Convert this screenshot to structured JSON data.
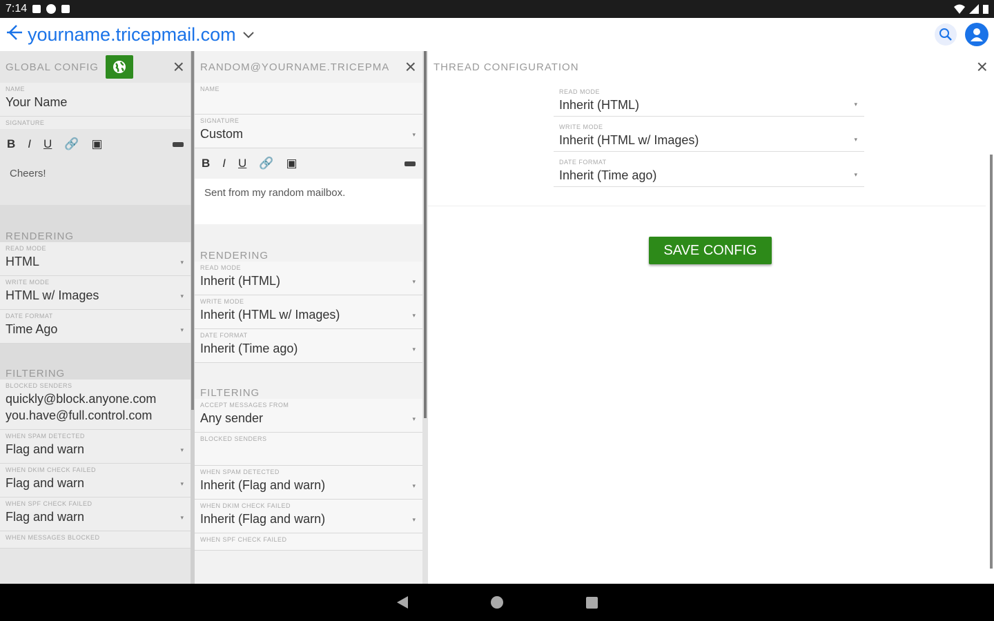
{
  "status": {
    "time": "7:14"
  },
  "appbar": {
    "title": "yourname.tricepmail.com",
    "title_prefix": "yourname",
    "title_suffix": ".tricepmail.com"
  },
  "global": {
    "header": "GLOBAL CONFIG",
    "name_label": "NAME",
    "name_value": "Your Name",
    "signature_label": "SIGNATURE",
    "signature_text": "Cheers!",
    "rendering_title": "RENDERING",
    "read_mode_label": "READ MODE",
    "read_mode": "HTML",
    "write_mode_label": "WRITE MODE",
    "write_mode": "HTML w/ Images",
    "date_format_label": "DATE FORMAT",
    "date_format": "Time Ago",
    "filtering_title": "FILTERING",
    "blocked_label": "BLOCKED SENDERS",
    "blocked_1": "quickly@block.anyone.com",
    "blocked_2": "you.have@full.control.com",
    "spam_label": "WHEN SPAM DETECTED",
    "spam_value": "Flag and warn",
    "dkim_label": "WHEN DKIM CHECK FAILED",
    "dkim_value": "Flag and warn",
    "spf_label": "WHEN SPF CHECK FAILED",
    "spf_value": "Flag and warn",
    "blocked_msg_label": "WHEN MESSAGES BLOCKED"
  },
  "mailbox": {
    "header": "RANDOM@YOURNAME.TRICEPMA",
    "name_label": "NAME",
    "signature_label": "SIGNATURE",
    "signature_value": "Custom",
    "signature_text": "Sent from my random mailbox.",
    "rendering_title": "RENDERING",
    "read_mode_label": "READ MODE",
    "read_mode": "Inherit (HTML)",
    "write_mode_label": "WRITE MODE",
    "write_mode": "Inherit (HTML w/ Images)",
    "date_format_label": "DATE FORMAT",
    "date_format": "Inherit (Time ago)",
    "filtering_title": "FILTERING",
    "accept_label": "ACCEPT MESSAGES FROM",
    "accept_value": "Any sender",
    "blocked_label": "BLOCKED SENDERS",
    "spam_label": "WHEN SPAM DETECTED",
    "spam_value": "Inherit (Flag and warn)",
    "dkim_label": "WHEN DKIM CHECK FAILED",
    "dkim_value": "Inherit (Flag and warn)",
    "spf_label": "WHEN SPF CHECK FAILED"
  },
  "thread": {
    "header": "THREAD CONFIGURATION",
    "read_mode_label": "READ MODE",
    "read_mode": "Inherit (HTML)",
    "write_mode_label": "WRITE MODE",
    "write_mode": "Inherit (HTML w/ Images)",
    "date_format_label": "DATE FORMAT",
    "date_format": "Inherit (Time ago)",
    "save_label": "SAVE CONFIG"
  },
  "colors": {
    "accent": "#1a73e8",
    "save": "#2d8a19"
  }
}
